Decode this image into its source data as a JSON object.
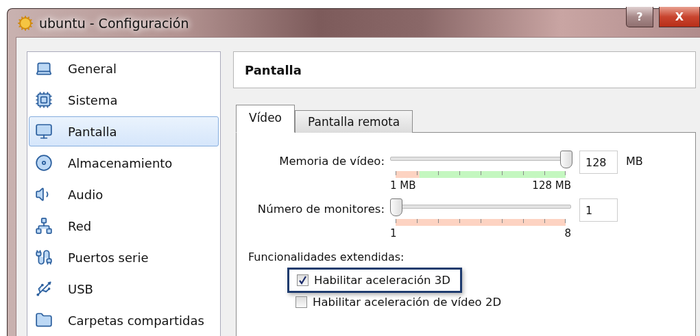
{
  "window": {
    "title": "ubuntu - Configuración",
    "buttons": [
      {
        "kind": "help",
        "label": "?"
      },
      {
        "kind": "close",
        "label": "X"
      }
    ]
  },
  "sidebar": {
    "items": [
      {
        "label": "General",
        "selected": false
      },
      {
        "label": "Sistema",
        "selected": false
      },
      {
        "label": "Pantalla",
        "selected": true
      },
      {
        "label": "Almacenamiento",
        "selected": false
      },
      {
        "label": "Audio",
        "selected": false
      },
      {
        "label": "Red",
        "selected": false
      },
      {
        "label": "Puertos serie",
        "selected": false
      },
      {
        "label": "USB",
        "selected": false
      },
      {
        "label": "Carpetas compartidas",
        "selected": false
      }
    ]
  },
  "panel": {
    "title": "Pantalla",
    "tabs": [
      {
        "label": "Vídeo",
        "selected": true
      },
      {
        "label": "Pantalla remota",
        "selected": false
      }
    ],
    "sliders": [
      {
        "label": "Memoria de vídeo:",
        "level": 1,
        "value": "128",
        "unit": "MB",
        "min_label": "1 MB",
        "max_label": "128 MB",
        "kind": "memory"
      },
      {
        "label": "Número de monitores:",
        "level": 0,
        "value": "1",
        "min_label": "1",
        "max_label": "8",
        "kind": "count"
      }
    ],
    "features": {
      "label": "Funcionalidades extendidas:",
      "options": [
        {
          "label": "Habilitar aceleración 3D",
          "checked": true,
          "highlighted": true
        },
        {
          "label": "Habilitar aceleración de vídeo 2D",
          "checked": false,
          "highlighted": false
        }
      ]
    }
  }
}
